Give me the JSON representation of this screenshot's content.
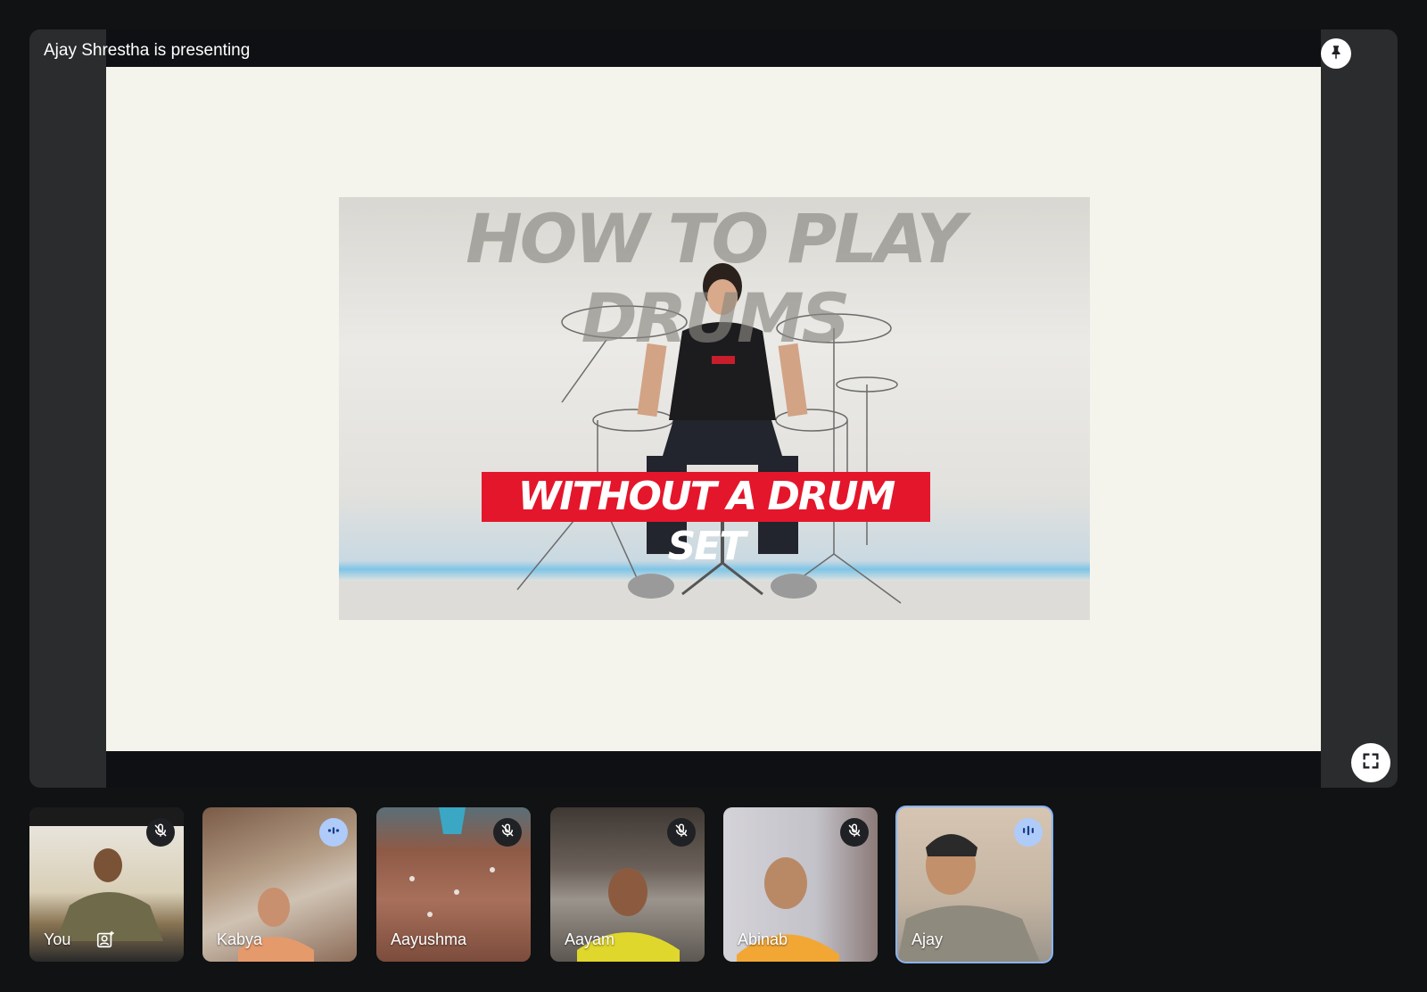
{
  "stage": {
    "presenter_label": "Ajay Shrestha is presenting",
    "pin_icon": "pin-icon",
    "fullscreen_icon": "fullscreen-icon"
  },
  "shared_content": {
    "thumbnail_title": "HOW TO PLAY DRUMS",
    "thumbnail_banner": "WITHOUT A DRUM SET",
    "banner_color": "#e4162b"
  },
  "participants": [
    {
      "name": "You",
      "mic": "muted",
      "video_colors": [
        "#cdbb8f",
        "#7d6a4a"
      ]
    },
    {
      "name": "Kabya",
      "mic": "speaking",
      "video_colors": [
        "#a78a6e",
        "#e2b192"
      ]
    },
    {
      "name": "Aayushma",
      "mic": "muted",
      "video_colors": [
        "#8a5a48",
        "#b07a63"
      ]
    },
    {
      "name": "Aayam",
      "mic": "muted",
      "video_colors": [
        "#5b5148",
        "#e0d72c"
      ]
    },
    {
      "name": "Abinab",
      "mic": "muted",
      "video_colors": [
        "#c7c7d0",
        "#f2a735"
      ]
    },
    {
      "name": "Ajay",
      "mic": "speaking",
      "video_colors": [
        "#c9b8a4",
        "#8f8a7e"
      ],
      "active": true
    }
  ],
  "colors": {
    "background": "#111213",
    "stage": "#2b2c2e",
    "speaking_accent": "#aecbfa",
    "active_outline": "#8ab4f8"
  }
}
